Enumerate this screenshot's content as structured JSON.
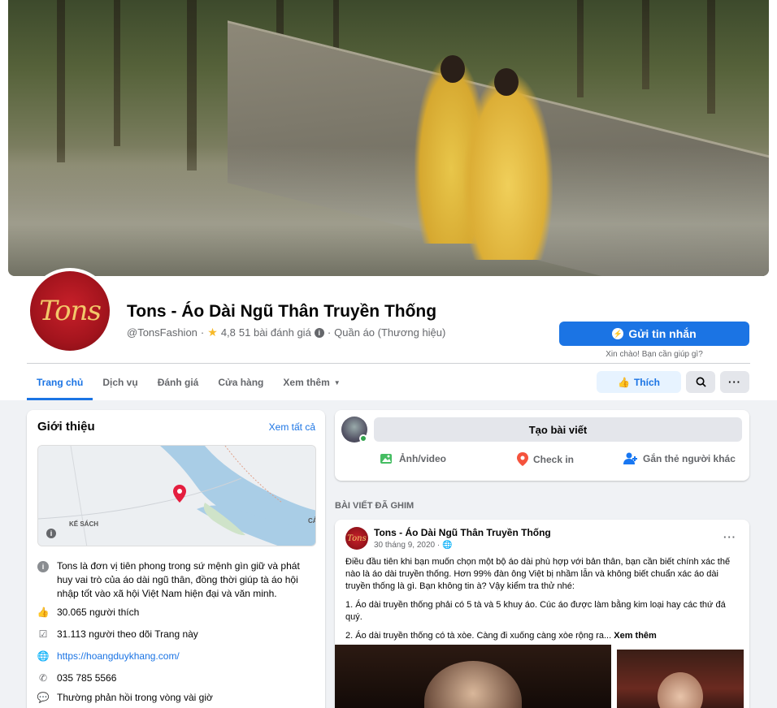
{
  "page": {
    "name": "Tons - Áo Dài Ngũ Thân Truyền Thống",
    "handle": "@TonsFashion",
    "rating": "4,8",
    "reviews": "51 bài đánh giá",
    "category": "Quần áo (Thương hiệu)",
    "avatar_text": "Tons"
  },
  "actions": {
    "message_label": "Gửi tin nhắn",
    "message_hint": "Xin chào! Bạn cần giúp gì?",
    "like_label": "Thích"
  },
  "tabs": [
    {
      "label": "Trang chủ"
    },
    {
      "label": "Dịch vụ"
    },
    {
      "label": "Đánh giá"
    },
    {
      "label": "Cửa hàng"
    },
    {
      "label": "Xem thêm"
    }
  ],
  "intro": {
    "title": "Giới thiệu",
    "see_all": "Xem tất cả",
    "map_label_1": "KẾ SÁCH",
    "map_label_2": "CẢ",
    "description": "Tons là đơn vị tiên phong trong sứ mệnh gìn giữ và phát huy vai trò của áo dài ngũ thân, đồng thời giúp tà áo hội nhập tốt vào xã hội Việt Nam hiện đại và văn minh.",
    "likes": "30.065 người thích",
    "followers": "31.113 người theo dõi Trang này",
    "website": "https://hoangduykhang.com/",
    "phone": "035 785 5566",
    "response": "Thường phản hồi trong vòng vài giờ"
  },
  "create_post": {
    "button": "Tạo bài viết",
    "photo": "Ảnh/video",
    "checkin": "Check in",
    "tag": "Gắn thẻ người khác"
  },
  "pinned_heading": "BÀI VIẾT ĐÃ GHIM",
  "post": {
    "author": "Tons - Áo Dài Ngũ Thân Truyền Thống",
    "date": "30 tháng 9, 2020 · ",
    "avatar_text": "Tons",
    "para1": "Điều đầu tiên khi bạn muốn chọn một bộ áo dài phù hợp với bản thân, bạn cần biết chính xác thế nào là áo dài truyền thống. Hơn 99% đàn ông Việt bị nhầm lẫn và không biết chuẩn xác áo dài truyền thống là gì. Bạn không tin à? Vậy kiểm tra thử nhé:",
    "para2": "1. Áo dài truyền thống phải có 5 tà và 5 khuy áo. Cúc áo được làm bằng kim loại hay các thứ đá quý.",
    "para3": "2. Áo dài truyền thống có tà xòe. Càng đi xuống càng xòe rộng ra...",
    "see_more": "Xem thêm"
  }
}
